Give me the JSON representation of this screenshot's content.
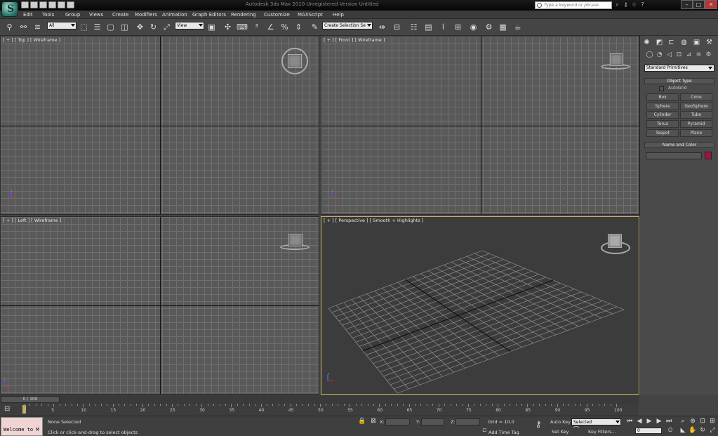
{
  "window": {
    "title": "Autodesk 3ds Max 2010    Unregistered Version     Untitled"
  },
  "search": {
    "placeholder": "Type a keyword or phrase"
  },
  "menu": [
    "Edit",
    "Tools",
    "Group",
    "Views",
    "Create",
    "Modifiers",
    "Animation",
    "Graph Editors",
    "Rendering",
    "Customize",
    "MAXScript",
    "Help"
  ],
  "toolbar": {
    "selection_filter": "All",
    "ref_coord": "View",
    "selection_set": "Create Selection Se"
  },
  "viewports": {
    "top": "[ + ] [ Top ] [ Wireframe ]",
    "front": "[ + ] [ Front ] [ Wireframe ]",
    "left": "[ + ] [ Left ] [ Wireframe ]",
    "perspective": "[ + ] [ Perspective ] [ Smooth + Highlights ]"
  },
  "command_panel": {
    "category": "Standard Primitives",
    "object_type_title": "Object Type",
    "autogrid": "AutoGrid",
    "primitives": [
      "Box",
      "Cone",
      "Sphere",
      "GeoSphere",
      "Cylinder",
      "Tube",
      "Torus",
      "Pyramid",
      "Teapot",
      "Plane"
    ],
    "name_color_title": "Name and Color",
    "object_color": "#a0133b"
  },
  "timeline": {
    "slider": "0 / 100",
    "ticks": [
      "0",
      "5",
      "10",
      "15",
      "20",
      "25",
      "30",
      "35",
      "40",
      "45",
      "50",
      "55",
      "60",
      "65",
      "70",
      "75",
      "80",
      "85",
      "90",
      "95",
      "100"
    ]
  },
  "status": {
    "listener": "Welcome to M",
    "selection": "None Selected",
    "prompt": "Click or click-and-drag to select objects",
    "x_label": "X:",
    "y_label": "Y:",
    "z_label": "Z:",
    "grid": "Grid = 10.0",
    "add_time_tag": "Add Time Tag",
    "auto_key": "Auto Key",
    "set_key": "Set Key",
    "key_mode": "Selected",
    "key_filters": "Key Filters...",
    "frame": "0"
  }
}
